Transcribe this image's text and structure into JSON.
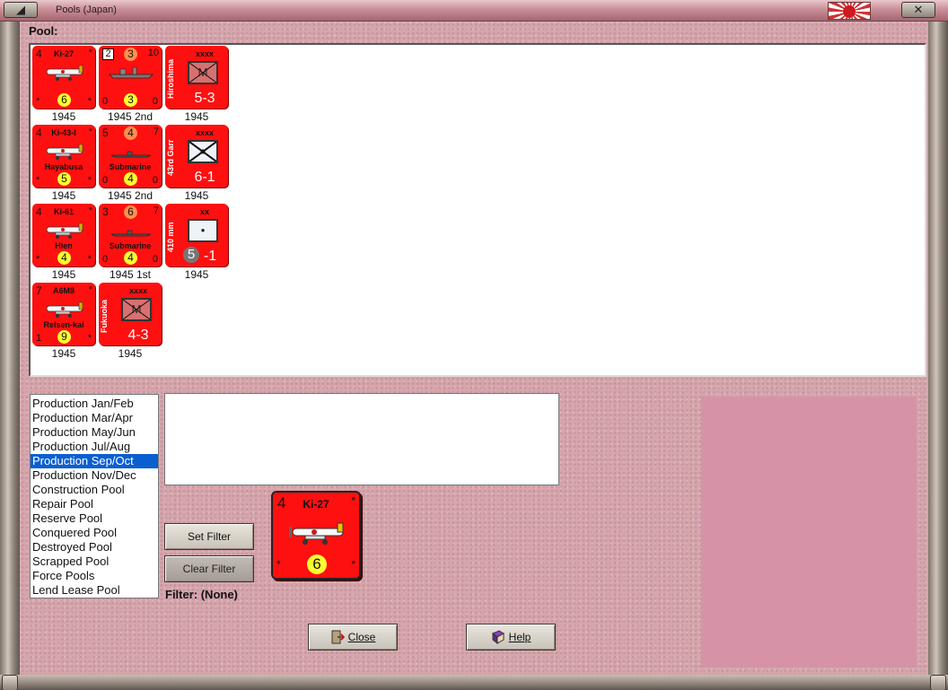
{
  "window": {
    "title": "Pools (Japan)",
    "minimize_glyph": "◢",
    "close_glyph": "✕"
  },
  "pool": {
    "label": "Pool:",
    "units": [
      {
        "kind": "air",
        "name": "Ki-27",
        "tl": "4",
        "tr": "*",
        "bl": "*",
        "br": "*",
        "circle": "6",
        "year": "1945"
      },
      {
        "kind": "naval",
        "box": "2",
        "top_circle": "3",
        "tr": "10",
        "bl": "0",
        "circle": "3",
        "br": "0",
        "year": "1945 2nd"
      },
      {
        "kind": "land",
        "vert": "Hiroshima",
        "size": "xxxx",
        "letter": "M",
        "big": "5-3",
        "year": "1945"
      },
      {
        "kind": "air",
        "name": "Ki-43-I",
        "sub": "Hayabusa",
        "tl": "4",
        "tr": "*",
        "bl": "*",
        "br": "*",
        "circle": "5",
        "year": "1945"
      },
      {
        "kind": "naval",
        "tl": "5",
        "top_circle": "4",
        "tr": "7",
        "sub": "Submarine",
        "bl": "0",
        "circle": "4",
        "br": "0",
        "year": "1945 2nd"
      },
      {
        "kind": "land",
        "vert": "43rd Garr",
        "size": "xxxx",
        "letter": "",
        "big": "6-1",
        "year": "1945"
      },
      {
        "kind": "air",
        "name": "Ki-61",
        "sub": "Hien",
        "tl": "4",
        "tr": "*",
        "bl": "*",
        "br": "*",
        "circle": "4",
        "year": "1945"
      },
      {
        "kind": "naval",
        "tl": "3",
        "top_circle": "6",
        "tr": "7",
        "sub": "Submarine",
        "bl": "0",
        "circle": "4",
        "br": "0",
        "year": "1945 1st"
      },
      {
        "kind": "land",
        "vert": "410 mm",
        "size": "xx",
        "letter": "•",
        "big_circle": "5",
        "big": "-1",
        "year": "1945"
      },
      {
        "kind": "air",
        "name": "A6M8",
        "sub": "Reisen-kai",
        "tl": "7",
        "tr": "*",
        "bl": "1",
        "br": "*",
        "circle": "9",
        "year": "1945"
      },
      {
        "kind": "land",
        "vert": "Fukuoka",
        "size": "xxxx",
        "letter": "M",
        "big": "4-3",
        "year": "1945"
      }
    ]
  },
  "pool_list": {
    "items": [
      "Production Jan/Feb",
      "Production Mar/Apr",
      "Production May/Jun",
      "Production Jul/Aug",
      "Production Sep/Oct",
      "Production Nov/Dec",
      "Construction Pool",
      "Repair Pool",
      "Reserve Pool",
      "Conquered Pool",
      "Destroyed Pool",
      "Scrapped Pool",
      "Force Pools",
      "Lend Lease Pool"
    ],
    "selected": "Production Sep/Oct"
  },
  "filter": {
    "set_label": "Set Filter",
    "clear_label": "Clear Filter",
    "status": "Filter: (None)"
  },
  "selected_unit": {
    "name": "Ki-27",
    "tl": "4",
    "tr": "*",
    "bl": "*",
    "br": "*",
    "circle": "6"
  },
  "buttons": {
    "close_label": "Close",
    "help_label": "Help"
  },
  "colors": {
    "counter_red": "#ff1010",
    "client_pink": "#d6a6ad",
    "preview_pink": "#d693a8",
    "selection_blue": "#0a5fd0"
  }
}
